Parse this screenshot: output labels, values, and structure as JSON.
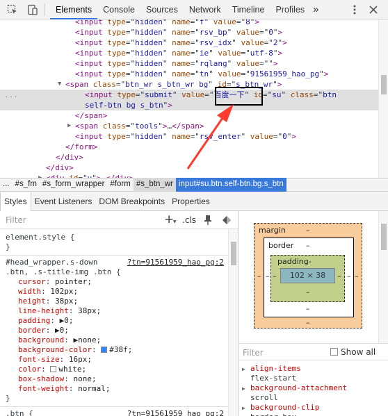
{
  "tabs": [
    "Elements",
    "Console",
    "Sources",
    "Network",
    "Timeline",
    "Profiles"
  ],
  "more_tabs": "»",
  "dom_lines": [
    {
      "indent": 7,
      "tri": "",
      "html": "<span class=\"tag\">&lt;input</span> <span class=\"attr\">type</span>=\"<span class=\"val\">hidden</span>\" <span class=\"attr\">name</span>=\"<span class=\"val\">f</span>\" <span class=\"attr\">value</span>=\"<span class=\"val\">8</span>\"<span class=\"tag\">&gt;</span>"
    },
    {
      "indent": 7,
      "tri": "",
      "html": "<span class=\"tag\">&lt;input</span> <span class=\"attr\">type</span>=\"<span class=\"val\">hidden</span>\" <span class=\"attr\">name</span>=\"<span class=\"val\">rsv_bp</span>\" <span class=\"attr\">value</span>=\"<span class=\"val\">0</span>\"<span class=\"tag\">&gt;</span>"
    },
    {
      "indent": 7,
      "tri": "",
      "html": "<span class=\"tag\">&lt;input</span> <span class=\"attr\">type</span>=\"<span class=\"val\">hidden</span>\" <span class=\"attr\">name</span>=\"<span class=\"val\">rsv_idx</span>\" <span class=\"attr\">value</span>=\"<span class=\"val\">2</span>\"<span class=\"tag\">&gt;</span>"
    },
    {
      "indent": 7,
      "tri": "",
      "html": "<span class=\"tag\">&lt;input</span> <span class=\"attr\">type</span>=\"<span class=\"val\">hidden</span>\" <span class=\"attr\">name</span>=\"<span class=\"val\">ie</span>\" <span class=\"attr\">value</span>=\"<span class=\"val\">utf-8</span>\"<span class=\"tag\">&gt;</span>"
    },
    {
      "indent": 7,
      "tri": "",
      "html": "<span class=\"tag\">&lt;input</span> <span class=\"attr\">type</span>=\"<span class=\"val\">hidden</span>\" <span class=\"attr\">name</span>=\"<span class=\"val\">rqlang</span>\" <span class=\"attr\">value</span>=\"<span class=\"val\"></span>\"<span class=\"tag\">&gt;</span>"
    },
    {
      "indent": 7,
      "tri": "",
      "html": "<span class=\"tag\">&lt;input</span> <span class=\"attr\">type</span>=\"<span class=\"val\">hidden</span>\" <span class=\"attr\">name</span>=\"<span class=\"val\">tn</span>\" <span class=\"attr\">value</span>=\"<span class=\"val\">91561959_hao_pg</span>\"<span class=\"tag\">&gt;</span>"
    },
    {
      "indent": 6,
      "tri": "▼",
      "html": "<span class=\"tag\">&lt;span</span> <span class=\"attr\">class</span>=\"<span class=\"val\">btn_wr s_btn_wr bg</span>\" <span class=\"attr\">id</span>=\"<span class=\"val\">s_btn_wr</span>\"<span class=\"tag\">&gt;</span>"
    },
    {
      "indent": 8,
      "tri": "",
      "sel": true,
      "html": "<span class=\"tag\">&lt;input</span> <span class=\"attr\">type</span>=\"<span class=\"val\">submit</span>\" <span class=\"attr\">value</span>=\"<span class=\"val\">百度一下</span>\" <span class=\"attr\">id</span>=\"<span class=\"val\">su</span>\" <span class=\"attr\">class</span>=\"<span class=\"val\">btn</span>"
    },
    {
      "indent": 8,
      "tri": "",
      "sel": true,
      "html": "<span class=\"val\">self-btn bg s_btn</span>\"<span class=\"tag\">&gt;</span>"
    },
    {
      "indent": 7,
      "tri": "",
      "html": "<span class=\"tag\">&lt;/span&gt;</span>"
    },
    {
      "indent": 7,
      "tri": "▶",
      "html": "<span class=\"tag\">&lt;span</span> <span class=\"attr\">class</span>=\"<span class=\"val\">tools</span>\"<span class=\"tag\">&gt;</span>…<span class=\"tag\">&lt;/span&gt;</span>"
    },
    {
      "indent": 7,
      "tri": "",
      "html": "<span class=\"tag\">&lt;input</span> <span class=\"attr\">type</span>=\"<span class=\"val\">hidden</span>\" <span class=\"attr\">name</span>=\"<span class=\"val\">rsv_enter</span>\" <span class=\"attr\">value</span>=\"<span class=\"val\">0</span>\"<span class=\"tag\">&gt;</span>"
    },
    {
      "indent": 6,
      "tri": "",
      "html": "<span class=\"tag\">&lt;/form&gt;</span>"
    },
    {
      "indent": 5,
      "tri": "",
      "html": "<span class=\"tag\">&lt;/div&gt;</span>"
    },
    {
      "indent": 4,
      "tri": "",
      "html": "<span class=\"tag\">&lt;/div&gt;</span>"
    },
    {
      "indent": 4,
      "tri": "▶",
      "html": "<span class=\"tag\">&lt;div</span> <span class=\"attr\">id</span>=\"<span class=\"val\">u</span>\"<span class=\"tag\">&gt;</span>…<span class=\"tag\">&lt;/div&gt;</span>"
    }
  ],
  "ellipsis_marker": "...",
  "breadcrumbs": [
    {
      "label": "...",
      "state": ""
    },
    {
      "label": "#s_fm",
      "state": ""
    },
    {
      "label": "#s_form_wrapper",
      "state": ""
    },
    {
      "label": "#form",
      "state": ""
    },
    {
      "label": "#s_btn_wr",
      "state": "hl"
    },
    {
      "label": "input#su.btn.self-btn.bg.s_btn",
      "state": "sel"
    }
  ],
  "subtabs": [
    "Styles",
    "Event Listeners",
    "DOM Breakpoints",
    "Properties"
  ],
  "styles": {
    "filter_placeholder": "Filter",
    "plus": "+",
    "cls": ".cls",
    "element_style_open": "element.style {",
    "element_style_close": "}",
    "rule1_selector_a": "#head_wrapper.s-down",
    "rule1_link": "?tn=91561959_hao_pg:2",
    "rule1_selector_b": ".btn, .s-title-img .btn {",
    "props": [
      {
        "name": "cursor",
        "value": "pointer;"
      },
      {
        "name": "width",
        "value": "102px;"
      },
      {
        "name": "height",
        "value": "38px;"
      },
      {
        "name": "line-height",
        "value": "38px;"
      },
      {
        "name": "padding",
        "value": "▶0;"
      },
      {
        "name": "border",
        "value": "▶0;"
      },
      {
        "name": "background",
        "value": "▶none;"
      },
      {
        "name": "background-color",
        "value": "#38f;",
        "swatch": "#3388ff"
      },
      {
        "name": "font-size",
        "value": "16px;"
      },
      {
        "name": "color",
        "value": "white;",
        "swatch": "#ffffff"
      },
      {
        "name": "box-shadow",
        "value": "none;"
      },
      {
        "name": "font-weight",
        "value": "normal;"
      }
    ],
    "rule1_close": "}",
    "rule2_selector": ".btn {",
    "rule2_link": "?tn=91561959_hao_pg:2"
  },
  "boxmodel": {
    "margin": "margin",
    "border": "border",
    "padding": "padding-",
    "content": "102 × 38",
    "dash": "–"
  },
  "computed": {
    "filter_placeholder": "Filter",
    "show_all": "Show all",
    "items": [
      {
        "name": "align-items",
        "value": "flex-start"
      },
      {
        "name": "background-attachment",
        "value": "scroll"
      },
      {
        "name": "background-clip",
        "value": "border-box"
      }
    ]
  },
  "colors": {
    "accent": "#3879d9",
    "arrow": "#ff3b30",
    "margin_box": "#f9cc9d",
    "padding_box": "#c3d08b",
    "content_box": "#8cb6c0"
  }
}
